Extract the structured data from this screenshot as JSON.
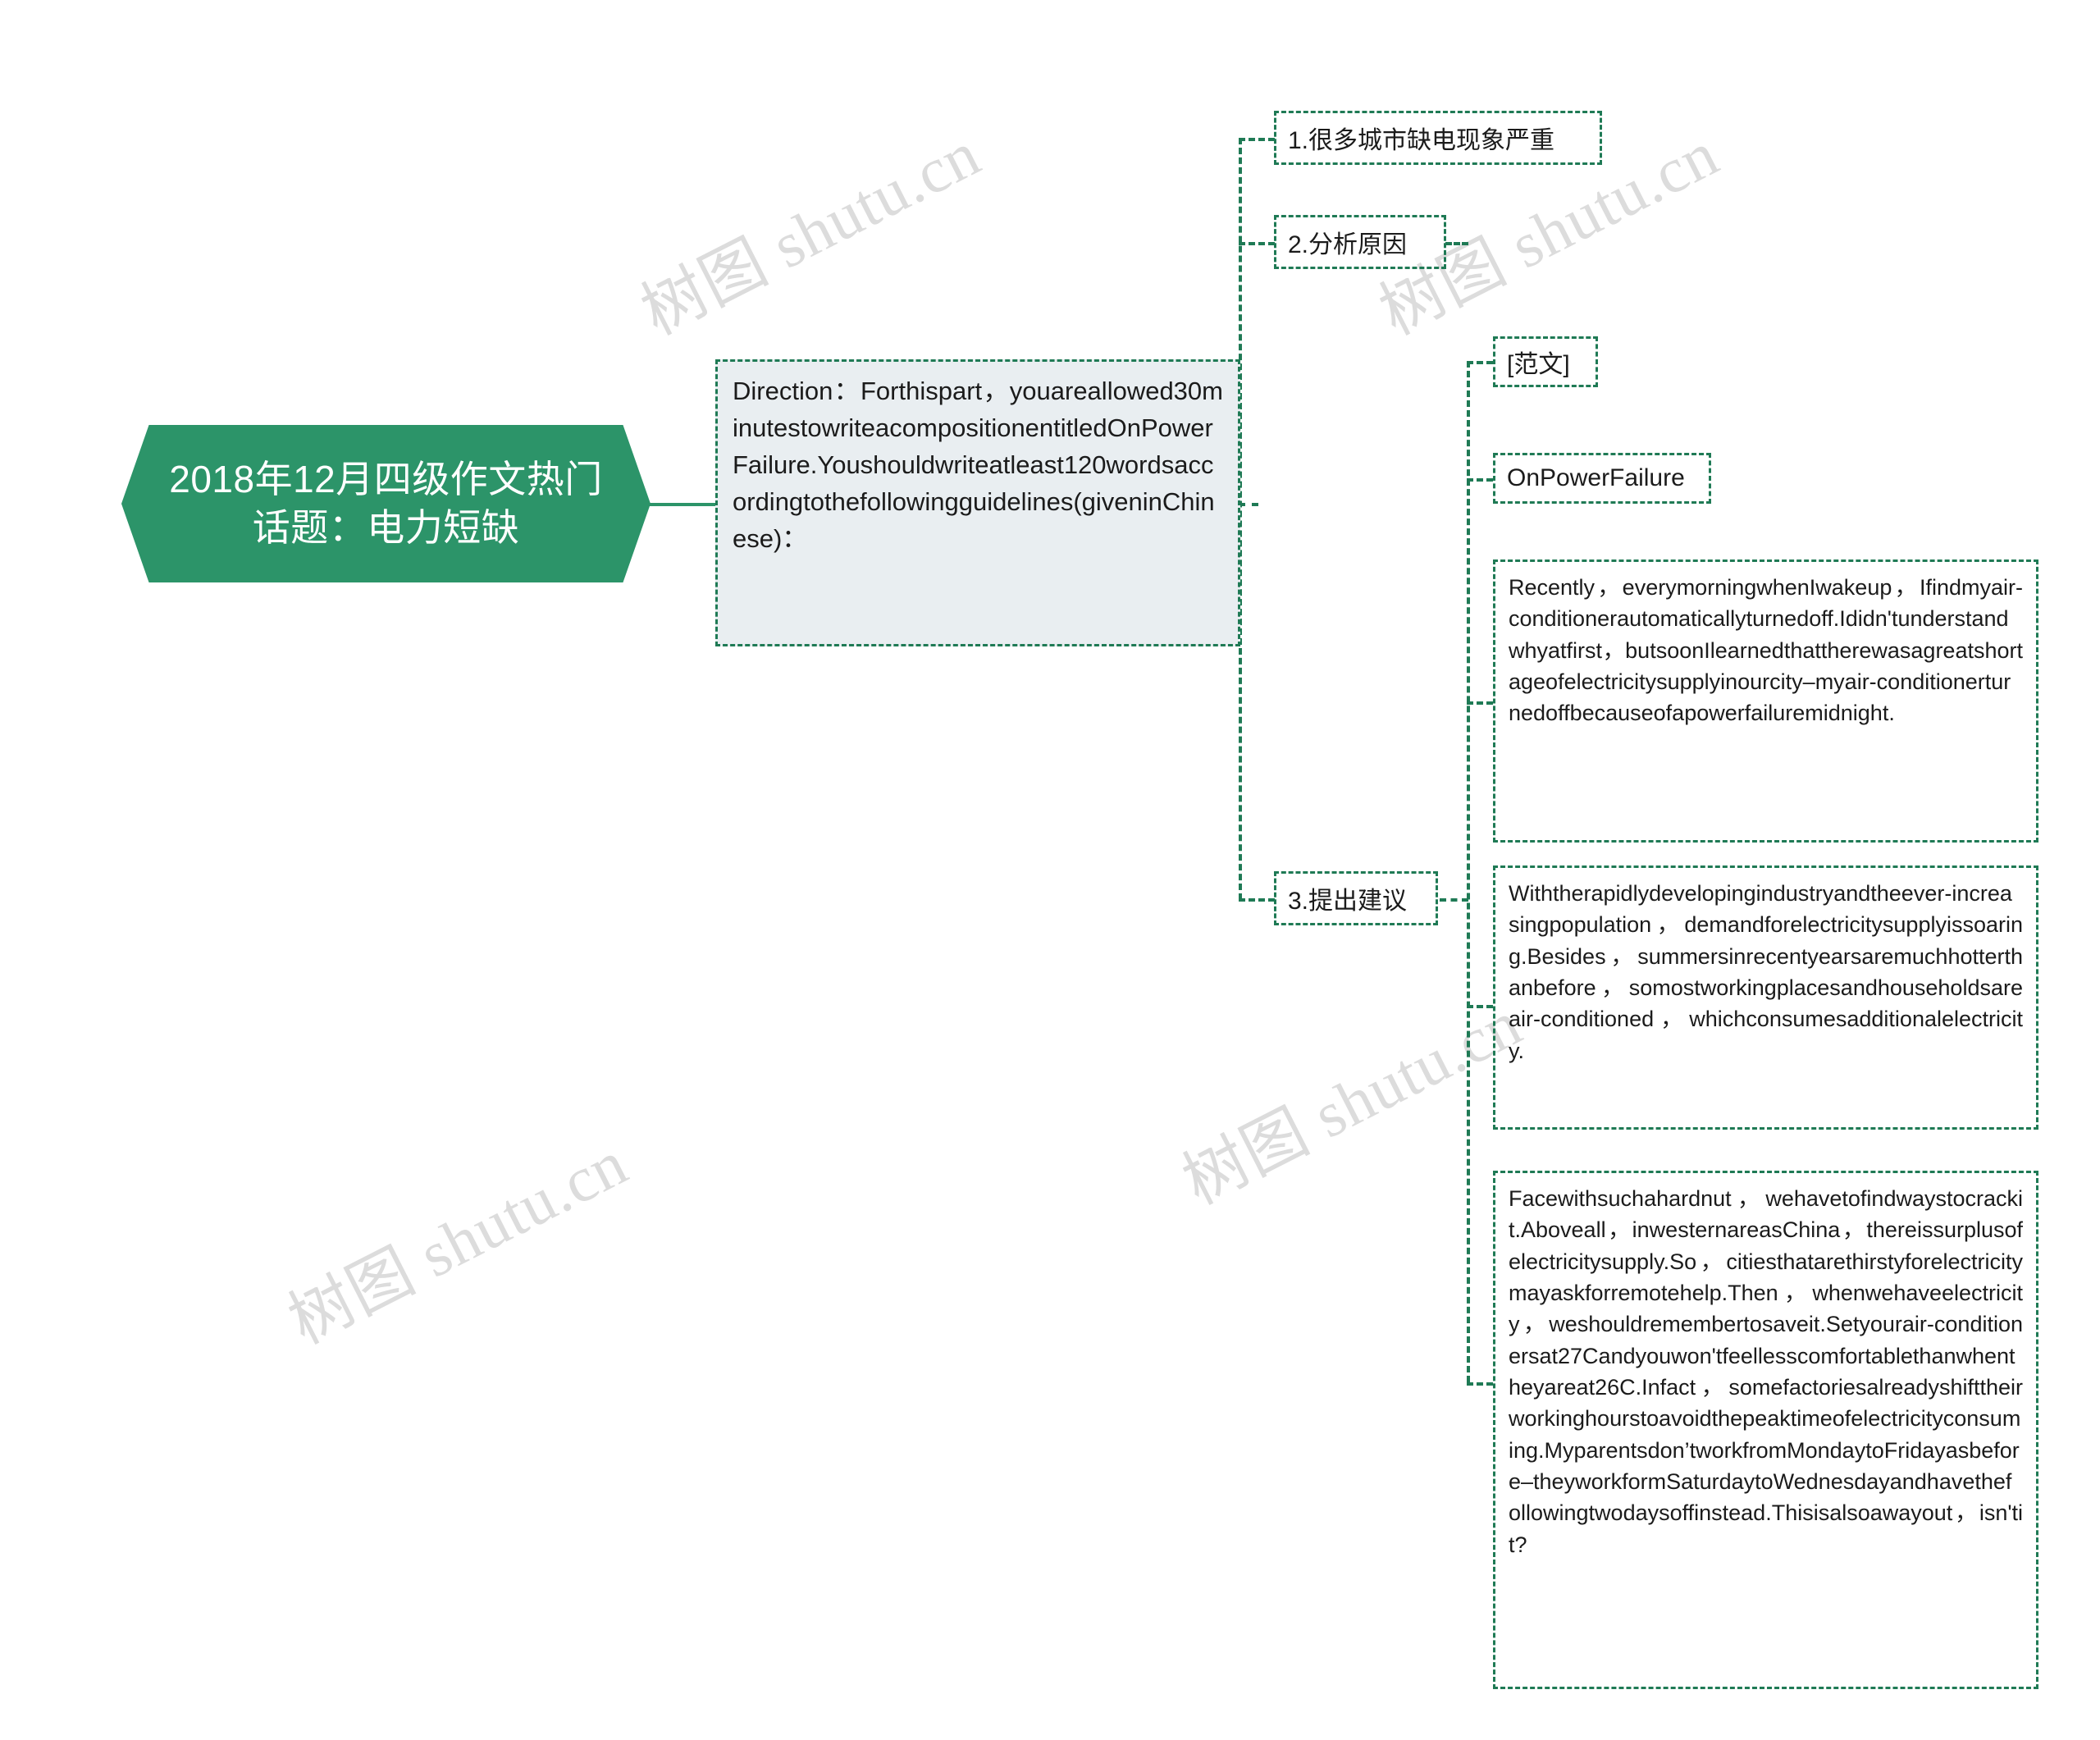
{
  "meta": {
    "background_color": "#ffffff",
    "accent_color": "#2c9469",
    "border_color": "#1f7a55",
    "direction_box_fill": "#e9eef1",
    "text_color": "#1b1b1b",
    "watermark_color": "#dcdcdc"
  },
  "watermark": {
    "text": "树图 shutu.cn",
    "cn": "树图",
    "en": " shutu.cn"
  },
  "root": {
    "line1": "2018年12月四级作文热门",
    "line2": "话题：电力短缺",
    "full": "2018年12月四级作文热门话题：电力短缺"
  },
  "direction": {
    "text": "Direction：Forthispart，youareallowed30minutestowriteacompositionentitledOnPowerFailure.Youshouldwriteatleast120wordsaccordingtothefollowingguidelines(giveninChinese)："
  },
  "branches": [
    {
      "id": "b1",
      "label": "1.很多城市缺电现象严重"
    },
    {
      "id": "b2",
      "label": "2.分析原因"
    },
    {
      "id": "b3",
      "label": "3.提出建议"
    }
  ],
  "sample": {
    "tag": "[范文]",
    "title": "OnPowerFailure",
    "paragraphs": [
      "Recently，everymorningwhenIwakeup，Ifindmyair-conditionerautomaticallyturnedoff.Ididn'tunderstandwhyatfirst，butsoonIlearnedthattherewasagreatshortageofelectricitysupplyinourcity–myair-conditionerturnedoffbecauseofapowerfailuremidnight.",
      "Withtherapidlydevelopingindustryandtheever-increasingpopulation，demandforelectricitysupplyissoaring.Besides，summersinrecentyearsaremuchhotterthanbefore，somostworkingplacesandhouseholdsareair-conditioned，whichconsumesadditionalelectricity.",
      "Facewithsuchahardnut，wehavetofindwaystocrackit.Aboveall，inwesternareasChina，thereissurplusofelectricitysupply.So，citiesthatarethirstyforelectricitymayaskforremotehelp.Then，whenwehaveelectricity，weshouldremembertosaveit.Setyourair-conditionersat27Candyouwon'tfeellesscomfortablethanwhentheyareat26C.Infact，somefactoriesalreadyshifttheirworkinghourstoavoidthepeaktimeofelectricityconsuming.Myparentsdon’tworkfromMondaytoFridayasbefore–theyworkformSaturdaytoWednesdayandhavethefollowingtwodaysoffinstead.Thisisalsoawayout，isn'tit?"
    ]
  }
}
